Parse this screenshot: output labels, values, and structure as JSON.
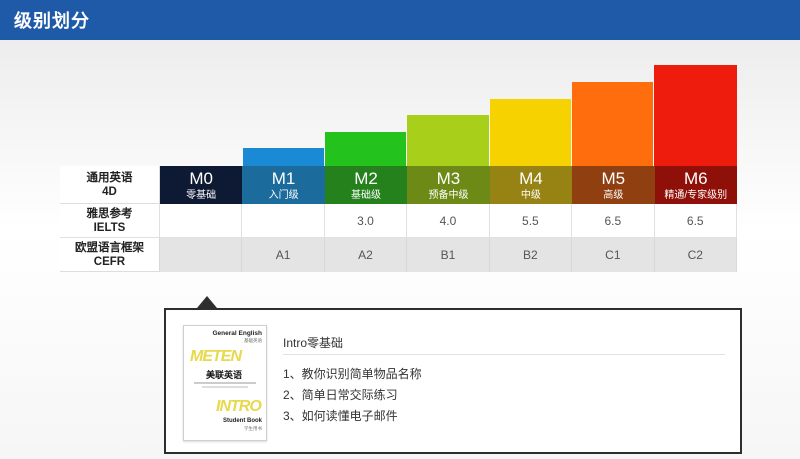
{
  "header": {
    "title": "级别划分"
  },
  "rows": {
    "general": {
      "cn": "通用英语",
      "en": "4D"
    },
    "ielts": {
      "cn": "雅思参考",
      "en": "IELTS"
    },
    "cefr": {
      "cn": "欧盟语言框架",
      "en": "CEFR"
    }
  },
  "levels": [
    {
      "code": "M0",
      "name": "零基础",
      "ielts": "",
      "cefr": "",
      "bar_color": "#0e1a33"
    },
    {
      "code": "M1",
      "name": "入门级",
      "ielts": "",
      "cefr": "A1",
      "bar_color": "#1a8ad4"
    },
    {
      "code": "M2",
      "name": "基础级",
      "ielts": "3.0",
      "cefr": "A2",
      "bar_color": "#24c21c"
    },
    {
      "code": "M3",
      "name": "预备中级",
      "ielts": "4.0",
      "cefr": "B1",
      "bar_color": "#a8d01a"
    },
    {
      "code": "M4",
      "name": "中级",
      "ielts": "5.5",
      "cefr": "B2",
      "bar_color": "#f6d200"
    },
    {
      "code": "M5",
      "name": "高级",
      "ielts": "6.5",
      "cefr": "C1",
      "bar_color": "#ff6d0c"
    },
    {
      "code": "M6",
      "name": "精通/专家级别",
      "ielts": "6.5",
      "cefr": "C2",
      "bar_color": "#ee1c0c"
    }
  ],
  "level_cell_colors": [
    "#0e1a33",
    "#1b6b9c",
    "#24811c",
    "#6e8a16",
    "#978214",
    "#8f3f10",
    "#8f1008"
  ],
  "detail": {
    "title": "Intro零基础",
    "items": [
      "1、教你识别简单物品名称",
      "2、简单日常交际练习",
      "3、如何读懂电子邮件"
    ]
  },
  "book": {
    "series": "General English",
    "series_sub": "基础英语",
    "logo": "METEN",
    "cn_title": "美联英语",
    "intro": "INTRO",
    "subtitle": "Student Book",
    "subtitle_sub": "学生用书"
  }
}
